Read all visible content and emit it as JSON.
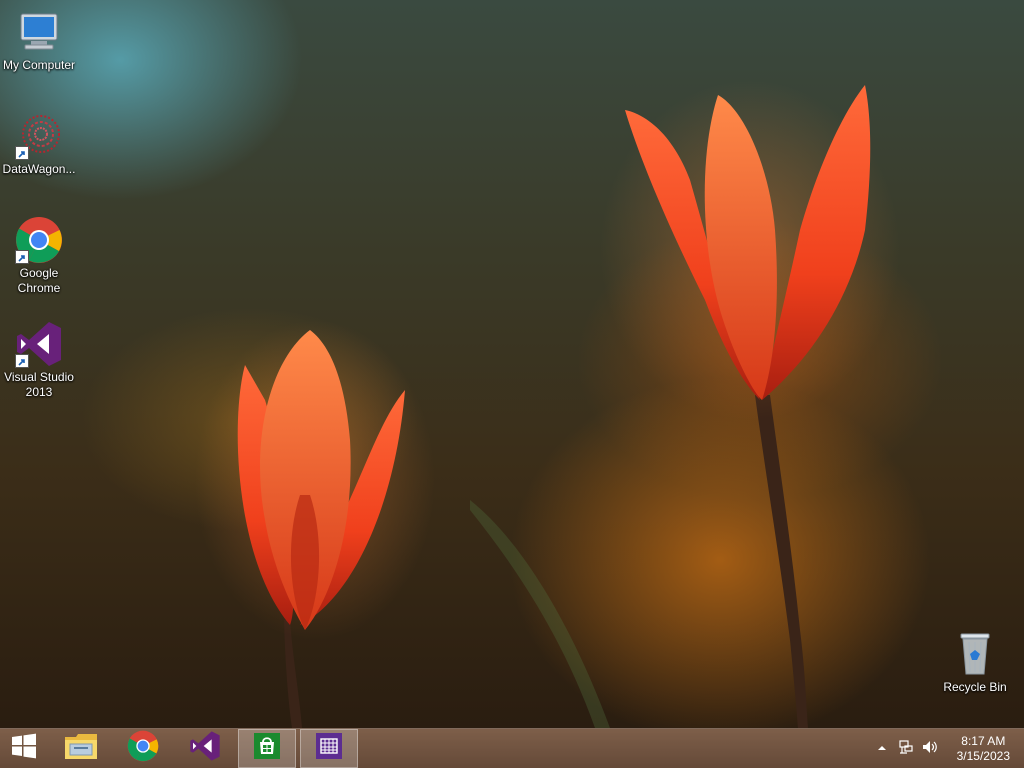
{
  "desktop": {
    "icons": [
      {
        "label": "My Computer",
        "icon": "computer-icon"
      },
      {
        "label": "DataWagon...",
        "icon": "datawagon-icon"
      },
      {
        "label": "Google Chrome",
        "icon": "chrome-icon"
      },
      {
        "label": "Visual Studio 2013",
        "icon": "visual-studio-icon"
      },
      {
        "label": "Recycle Bin",
        "icon": "recycle-bin-icon"
      }
    ]
  },
  "taskbar": {
    "pinned": [
      {
        "icon": "windows-start-icon",
        "active": false
      },
      {
        "icon": "file-explorer-icon",
        "active": false
      },
      {
        "icon": "chrome-icon",
        "active": false
      },
      {
        "icon": "visual-studio-icon",
        "active": false
      },
      {
        "icon": "store-icon",
        "active": true
      },
      {
        "icon": "calendar-app-icon",
        "active": true
      }
    ],
    "tray": {
      "icons": [
        "show-hidden-icons-icon",
        "network-icon",
        "volume-icon"
      ],
      "time": "8:17 AM",
      "date": "3/15/2023"
    }
  },
  "colors": {
    "taskbar": "#7a5842",
    "visual_studio_purple": "#68217a",
    "store_green": "#1b8a2e",
    "calendar_purple": "#5c2d91"
  }
}
